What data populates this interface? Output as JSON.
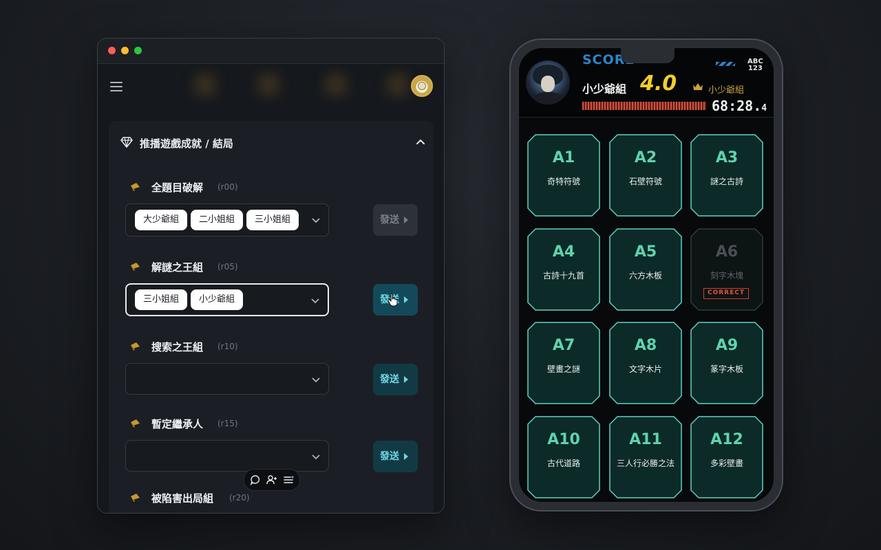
{
  "admin_panel": {
    "section_title": "推播遊戲成就 / 結局",
    "groups": [
      {
        "title": "全題目破解",
        "code": "(r00)",
        "chips": [
          "大少爺組",
          "二小姐組",
          "三小姐組"
        ],
        "send_label": "發送",
        "send_state": "disabled"
      },
      {
        "title": "解謎之王組",
        "code": "(r05)",
        "chips": [
          "三小姐組",
          "小少爺組"
        ],
        "send_label": "發送",
        "send_state": "hover"
      },
      {
        "title": "搜索之王組",
        "code": "(r10)",
        "chips": [],
        "send_label": "發送",
        "send_state": "enabled"
      },
      {
        "title": "暫定繼承人",
        "code": "(r15)",
        "chips": [],
        "send_label": "發送",
        "send_state": "enabled"
      },
      {
        "title": "被陷害出局組",
        "code": "(r20)"
      }
    ],
    "float_toolbar": [
      "chat-icon",
      "add-user-icon",
      "list-icon"
    ]
  },
  "phone": {
    "score_label": "SCORE",
    "abc_top": "ABC",
    "abc_bottom": "123",
    "team_name": "小少爺組",
    "score": "4.0",
    "leader_name": "小少爺組",
    "timer_main": "68:28.",
    "timer_fraction": "4",
    "tiles": [
      {
        "code": "A1",
        "name": "奇特符號"
      },
      {
        "code": "A2",
        "name": "石壁符號"
      },
      {
        "code": "A3",
        "name": "謎之古詩"
      },
      {
        "code": "A4",
        "name": "古詩十九首"
      },
      {
        "code": "A5",
        "name": "六方木板"
      },
      {
        "code": "A6",
        "name": "刻字木塊",
        "status": "CORRECT"
      },
      {
        "code": "A7",
        "name": "壁畫之謎"
      },
      {
        "code": "A8",
        "name": "文字木片"
      },
      {
        "code": "A9",
        "name": "篆字木板"
      },
      {
        "code": "A10",
        "name": "古代道路"
      },
      {
        "code": "A11",
        "name": "三人行必勝之法"
      },
      {
        "code": "A12",
        "name": "多彩壁畫"
      }
    ]
  },
  "colors": {
    "accent_teal": "#5fd3ad",
    "send_text": "#6fd7e6",
    "score_yellow": "#f2cf2a",
    "score_blue": "#2b86c9",
    "correct_red": "#d1402e"
  }
}
